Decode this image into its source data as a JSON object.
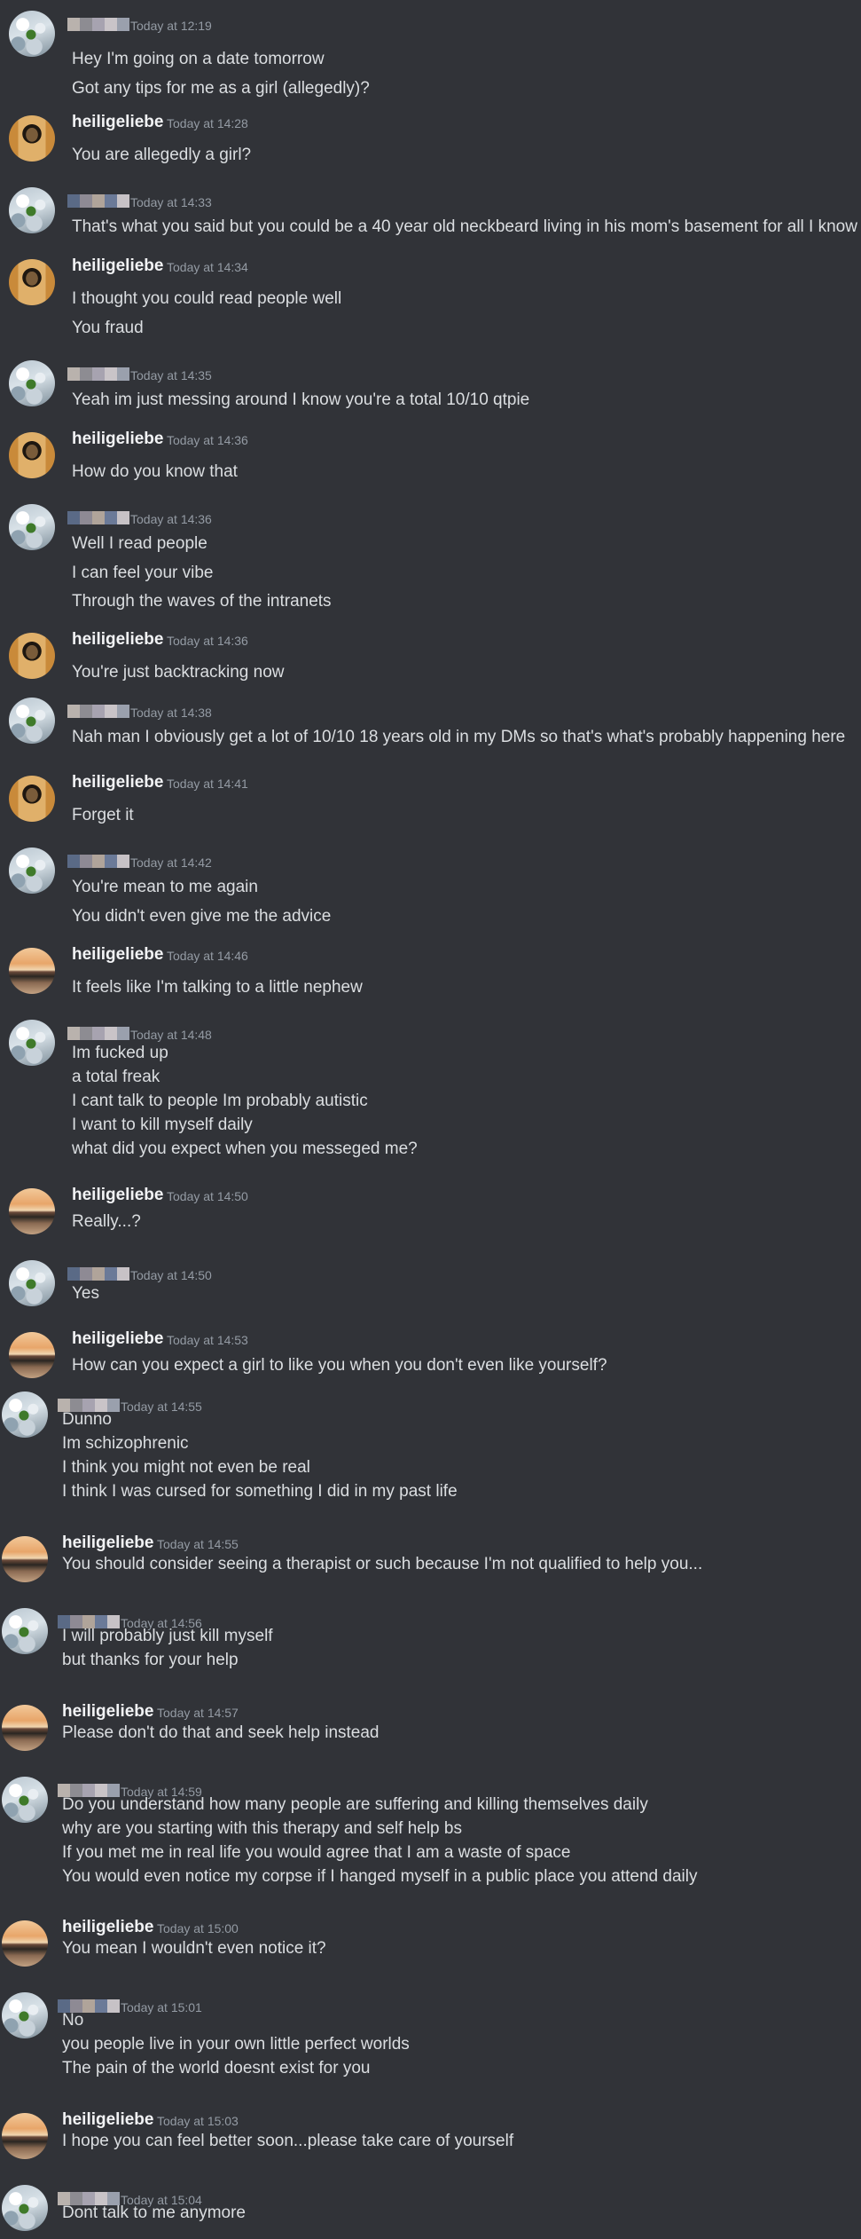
{
  "colors": {
    "background": "#313338",
    "username": "#f2f3f5",
    "timestamp": "#949ba4",
    "message_text": "#dbdee1"
  },
  "users": {
    "other": {
      "name": "",
      "avatar_icon": "snowy-plant-avatar-icon",
      "name_redacted": true
    },
    "heili_a": {
      "name": "heiligeliebe",
      "avatar_icon": "lamp-avatar-icon"
    },
    "heili_b": {
      "name": "heiligeliebe",
      "avatar_icon": "sunset-avatar-icon"
    }
  },
  "messages": [
    {
      "user": "other",
      "timestamp": "Today at 12:19",
      "lines": [
        "Hey I'm going on a date tomorrow",
        "Got any tips for me as a girl (allegedly)?"
      ]
    },
    {
      "user": "heili_a",
      "timestamp": "Today at 14:28",
      "lines": [
        "You are allegedly a girl?"
      ]
    },
    {
      "user": "other",
      "timestamp": "Today at 14:33",
      "lines": [
        "That's what you said but you could be a 40 year old neckbeard living in his mom's basement for all I know"
      ]
    },
    {
      "user": "heili_a",
      "timestamp": "Today at 14:34",
      "lines": [
        "I thought you could read people well",
        "You fraud"
      ]
    },
    {
      "user": "other",
      "timestamp": "Today at 14:35",
      "lines": [
        "Yeah im just messing around I know you're a total 10/10 qtpie"
      ]
    },
    {
      "user": "heili_a",
      "timestamp": "Today at 14:36",
      "lines": [
        "How do you know that"
      ]
    },
    {
      "user": "other",
      "timestamp": "Today at 14:36",
      "lines": [
        "Well I read people",
        "I can feel your vibe",
        "Through the waves of the intranets"
      ]
    },
    {
      "user": "heili_a",
      "timestamp": "Today at 14:36",
      "lines": [
        "You're just backtracking now"
      ]
    },
    {
      "user": "other",
      "timestamp": "Today at 14:38",
      "lines": [
        "Nah man I  obviously get a lot of 10/10 18 years old in my DMs so that's what's probably happening here"
      ]
    },
    {
      "user": "heili_a",
      "timestamp": "Today at 14:41",
      "lines": [
        "Forget it"
      ]
    },
    {
      "user": "other",
      "timestamp": "Today at 14:42",
      "lines": [
        "You're mean to me again",
        "You didn't even give me the advice"
      ]
    },
    {
      "user": "heili_b",
      "timestamp": "Today at 14:46",
      "lines": [
        "It feels like I'm talking to a little nephew"
      ]
    },
    {
      "user": "other",
      "timestamp": "Today at 14:48",
      "lines": [
        "Im fucked up",
        "a total freak",
        "I cant talk to people Im probably autistic",
        "I want to kill myself daily",
        "what did you expect when you messeged me?"
      ]
    },
    {
      "user": "heili_b",
      "timestamp": "Today at 14:50",
      "lines": [
        "Really...?"
      ]
    },
    {
      "user": "other",
      "timestamp": "Today at 14:50",
      "lines": [
        "Yes"
      ]
    },
    {
      "user": "heili_b",
      "timestamp": "Today at 14:53",
      "lines": [
        "How can you expect a girl to like you when you don't even like yourself?"
      ]
    },
    {
      "user": "other",
      "timestamp": "Today at 14:55",
      "lines": [
        "Dunno",
        "Im schizophrenic",
        "I think you might not even be real",
        "I think I was cursed for something I did in my past life"
      ]
    },
    {
      "user": "heili_b",
      "timestamp": "Today at 14:55",
      "lines": [
        "You should consider seeing a therapist or such because I'm not qualified to help you..."
      ]
    },
    {
      "user": "other",
      "timestamp": "Today at 14:56",
      "lines": [
        "I will probably just kill myself",
        "but thanks for your help"
      ]
    },
    {
      "user": "heili_b",
      "timestamp": "Today at 14:57",
      "lines": [
        "Please don't do that and seek help instead"
      ]
    },
    {
      "user": "other",
      "timestamp": "Today at 14:59",
      "lines": [
        "Do you understand how many people are suffering and killing themselves daily",
        "why are you starting with this therapy and self help bs",
        "If you met me in real life you would agree that I am a waste of space",
        "You would even notice my corpse if I hanged myself in a public place you attend daily"
      ]
    },
    {
      "user": "heili_b",
      "timestamp": "Today at 15:00",
      "lines": [
        "You mean I wouldn't even notice it?"
      ]
    },
    {
      "user": "other",
      "timestamp": "Today at 15:01",
      "lines": [
        "No",
        " you people live in your own little perfect worlds",
        " The pain of the world doesnt exist for you"
      ]
    },
    {
      "user": "heili_b",
      "timestamp": "Today at 15:03",
      "lines": [
        "I hope you can feel better soon...please take care of yourself"
      ]
    },
    {
      "user": "other",
      "timestamp": "Today at 15:04",
      "lines": [
        "Dont talk to me anymore"
      ]
    }
  ]
}
